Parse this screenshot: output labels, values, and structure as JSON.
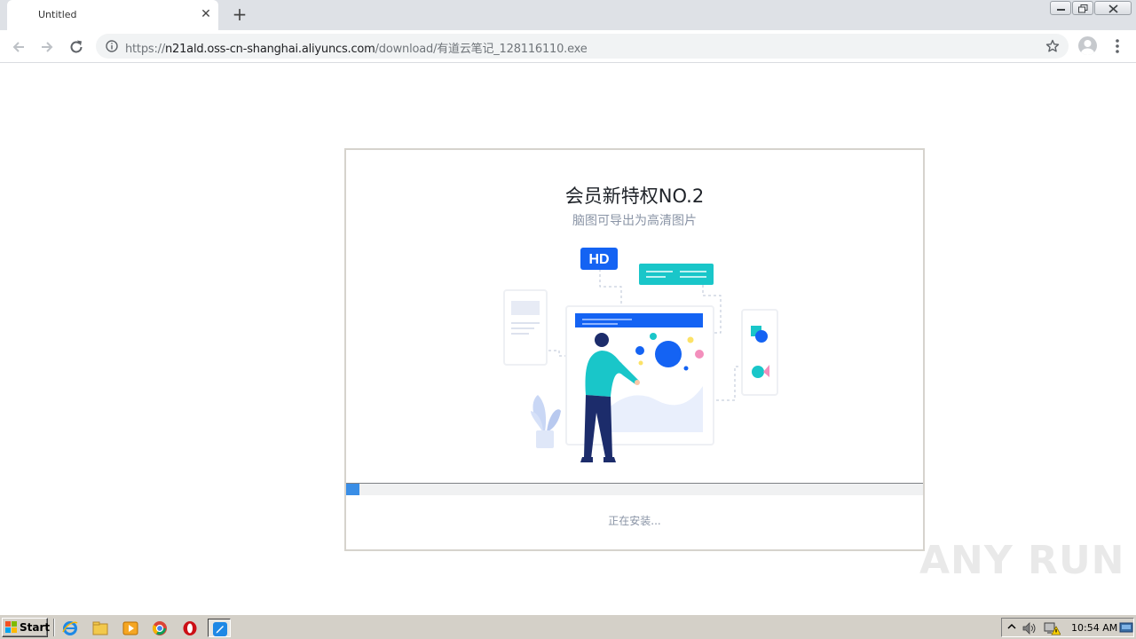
{
  "browser": {
    "tab_title": "Untitled",
    "new_tab_symbol": "+",
    "close_symbol": "✕",
    "url": {
      "prefix": "https://",
      "host": "n21ald.oss-cn-shanghai.aliyuncs.com",
      "path": "/download/有道云笔记_128116110.exe"
    },
    "icons": [
      "back-arrow-icon",
      "forward-arrow-icon",
      "reload-icon",
      "info-icon",
      "star-icon",
      "profile-icon",
      "menu-icon"
    ]
  },
  "installer": {
    "title": "会员新特权NO.2",
    "subtitle": "脑图可导出为高清图片",
    "badge": "HD",
    "progress": 0.023,
    "status": "正在安装..."
  },
  "watermark": "ANY RUN",
  "taskbar": {
    "start_label": "Start",
    "clock": "10:54 AM",
    "apps": [
      "internet-explorer-icon",
      "folder-icon",
      "media-player-icon",
      "chrome-icon",
      "opera-icon",
      "installer-app-icon"
    ]
  },
  "colors": {
    "accent_blue": "#1463f3",
    "teal": "#19c6c9",
    "progress_blue": "#3a8ee6",
    "title_text": "#1f2329",
    "subtle_text": "#8a94a6"
  }
}
